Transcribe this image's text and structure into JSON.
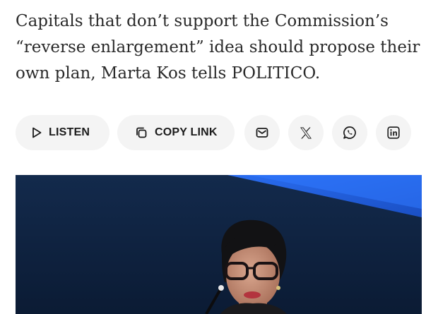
{
  "article": {
    "subtitle": "Capitals that don’t support the Commission’s “reverse enlargement” idea should propose their own plan, Marta Kos tells POLITICO."
  },
  "share_bar": {
    "listen_label": "LISTEN",
    "copy_link_label": "COPY LINK",
    "buttons": [
      {
        "name": "email",
        "icon": "envelope-icon"
      },
      {
        "name": "x",
        "icon": "x-logo-icon"
      },
      {
        "name": "whatsapp",
        "icon": "whatsapp-icon"
      },
      {
        "name": "linkedin",
        "icon": "linkedin-icon"
      }
    ]
  },
  "image": {
    "subject": "Marta Kos speaking at a microphone on stage"
  },
  "colors": {
    "text": "#2a2a2a",
    "button_bg": "#f4f4f4",
    "stage_blue": "#1f5bd8"
  }
}
